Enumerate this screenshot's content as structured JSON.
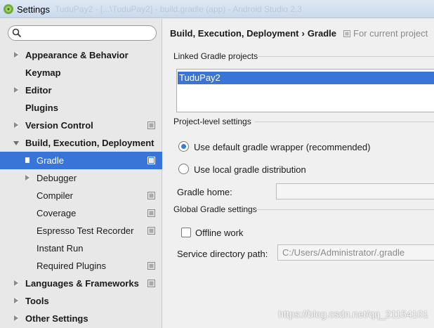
{
  "window": {
    "title": "Settings",
    "ghost_title": "TuduPay2 - [...\\TuduPay2] - build.gradle (app) - Android Studio 2.3"
  },
  "search": {
    "placeholder": ""
  },
  "tree": {
    "items": [
      {
        "label": "Appearance & Behavior",
        "bold": true,
        "indent": 0,
        "arrow": "right",
        "project": false
      },
      {
        "label": "Keymap",
        "bold": true,
        "indent": 0,
        "arrow": "",
        "project": false
      },
      {
        "label": "Editor",
        "bold": true,
        "indent": 0,
        "arrow": "right",
        "project": false
      },
      {
        "label": "Plugins",
        "bold": true,
        "indent": 0,
        "arrow": "",
        "project": false
      },
      {
        "label": "Version Control",
        "bold": true,
        "indent": 0,
        "arrow": "right",
        "project": true
      },
      {
        "label": "Build, Execution, Deployment",
        "bold": true,
        "indent": 0,
        "arrow": "down",
        "project": false
      },
      {
        "label": "Gradle",
        "bold": false,
        "indent": 1,
        "arrow": "right",
        "project": true,
        "selected": true
      },
      {
        "label": "Debugger",
        "bold": false,
        "indent": 1,
        "arrow": "right",
        "project": false
      },
      {
        "label": "Compiler",
        "bold": false,
        "indent": 1,
        "arrow": "",
        "project": true
      },
      {
        "label": "Coverage",
        "bold": false,
        "indent": 1,
        "arrow": "",
        "project": true
      },
      {
        "label": "Espresso Test Recorder",
        "bold": false,
        "indent": 1,
        "arrow": "",
        "project": true
      },
      {
        "label": "Instant Run",
        "bold": false,
        "indent": 1,
        "arrow": "",
        "project": false
      },
      {
        "label": "Required Plugins",
        "bold": false,
        "indent": 1,
        "arrow": "",
        "project": true
      },
      {
        "label": "Languages & Frameworks",
        "bold": true,
        "indent": 0,
        "arrow": "right",
        "project": true
      },
      {
        "label": "Tools",
        "bold": true,
        "indent": 0,
        "arrow": "right",
        "project": false
      },
      {
        "label": "Other Settings",
        "bold": true,
        "indent": 0,
        "arrow": "right",
        "project": false
      }
    ]
  },
  "breadcrumb": {
    "parent": "Build, Execution, Deployment",
    "separator": "›",
    "current": "Gradle"
  },
  "scope_note": "For current project",
  "linked": {
    "section_title": "Linked Gradle projects",
    "projects": [
      "TuduPay2"
    ]
  },
  "project_level": {
    "section_title": "Project-level settings",
    "option_default": "Use default gradle wrapper (recommended)",
    "option_local": "Use local gradle distribution",
    "selected": "default",
    "gradle_home_label": "Gradle home:",
    "gradle_home_value": ""
  },
  "global": {
    "section_title": "Global Gradle settings",
    "offline_label": "Offline work",
    "offline_checked": false,
    "service_dir_label": "Service directory path:",
    "service_dir_value": "C:/Users/Administrator/.gradle"
  },
  "watermark": "https://blog.csdn.net/qq_21154101",
  "colors": {
    "selection": "#3875d7",
    "radio_dot": "#3a7bd5"
  }
}
